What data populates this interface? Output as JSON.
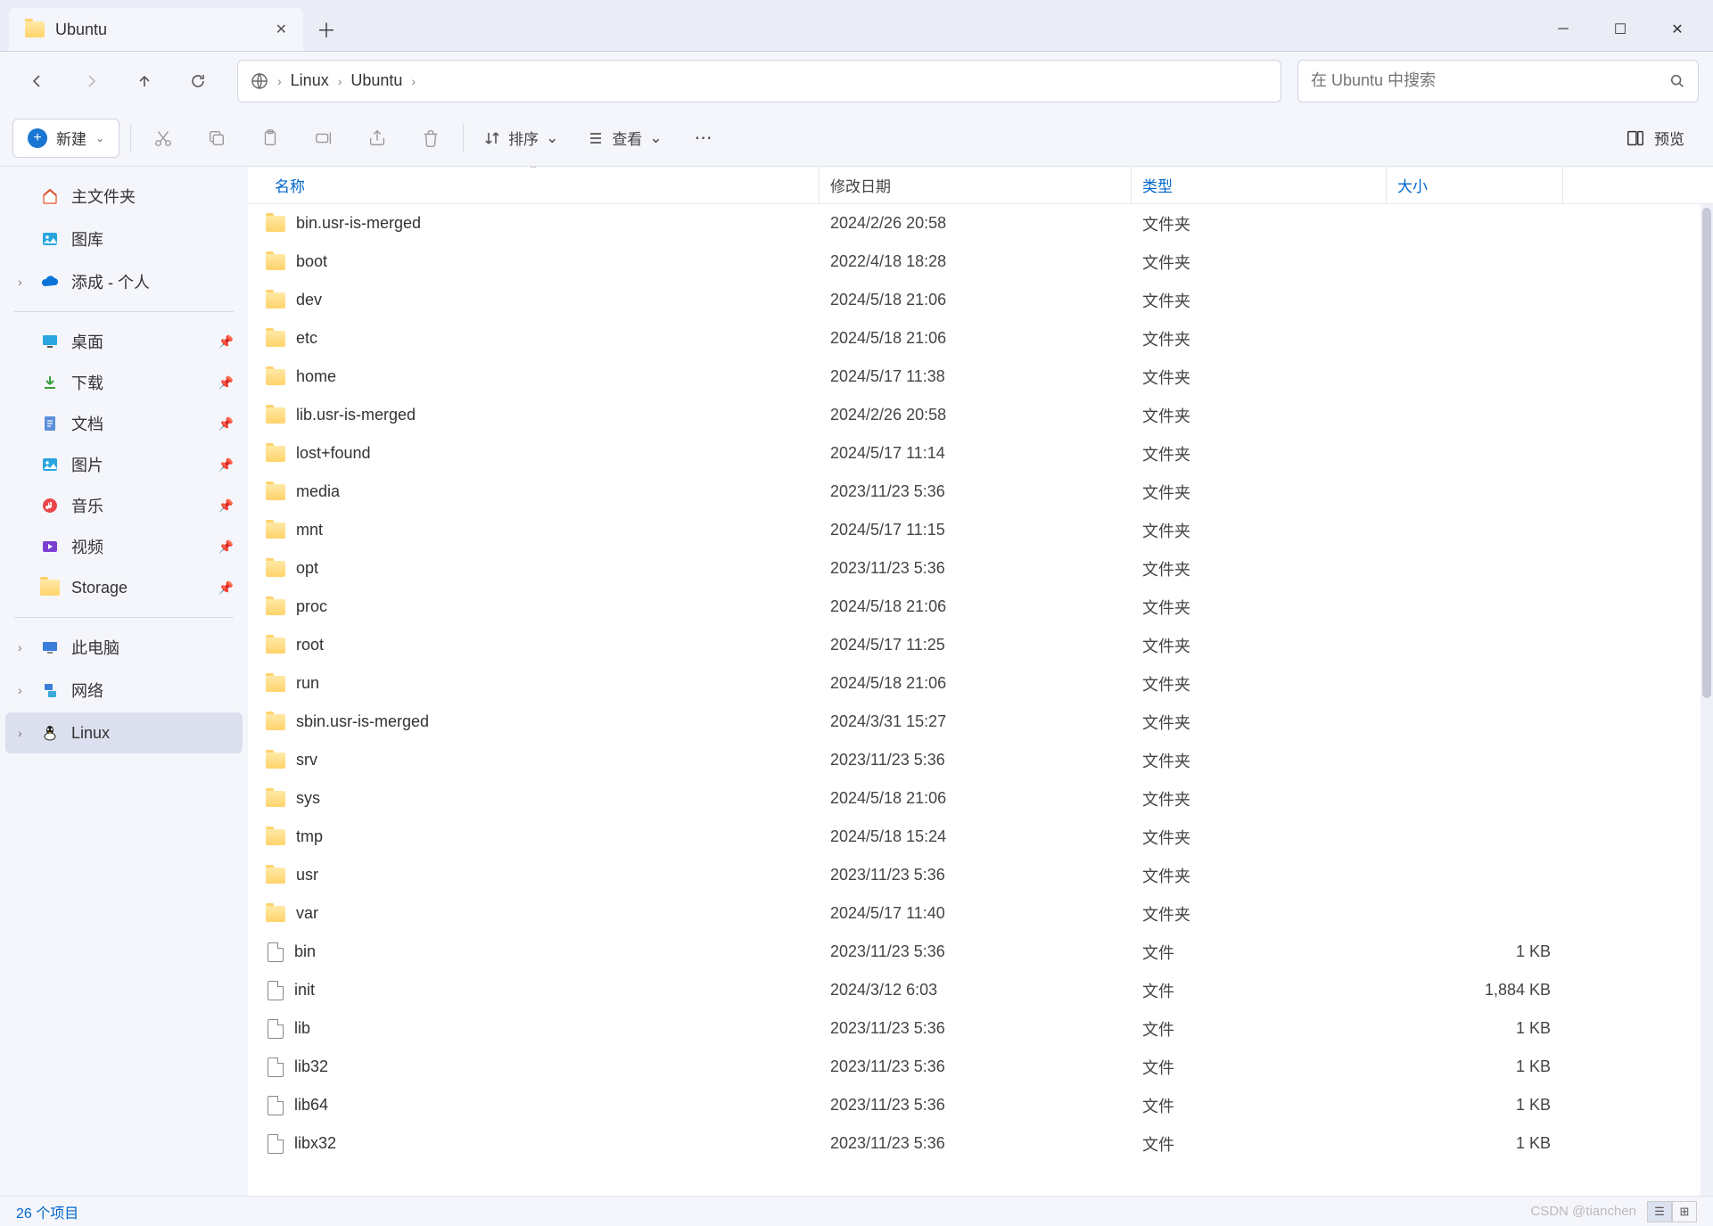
{
  "tab": {
    "title": "Ubuntu"
  },
  "breadcrumbs": [
    "Linux",
    "Ubuntu"
  ],
  "search": {
    "placeholder": "在 Ubuntu 中搜索"
  },
  "toolbar": {
    "new_label": "新建",
    "sort_label": "排序",
    "view_label": "查看",
    "preview_label": "预览"
  },
  "sidebar": {
    "home": "主文件夹",
    "gallery": "图库",
    "onedrive": "添成 - 个人",
    "quick": [
      {
        "label": "桌面",
        "icon": "desktop"
      },
      {
        "label": "下载",
        "icon": "download"
      },
      {
        "label": "文档",
        "icon": "document"
      },
      {
        "label": "图片",
        "icon": "picture"
      },
      {
        "label": "音乐",
        "icon": "music"
      },
      {
        "label": "视频",
        "icon": "video"
      },
      {
        "label": "Storage",
        "icon": "folder"
      }
    ],
    "thispc": "此电脑",
    "network": "网络",
    "linux": "Linux"
  },
  "columns": {
    "name": "名称",
    "date": "修改日期",
    "type": "类型",
    "size": "大小"
  },
  "type_folder": "文件夹",
  "type_file": "文件",
  "files": [
    {
      "name": "bin.usr-is-merged",
      "date": "2024/2/26 20:58",
      "type": "folder",
      "size": ""
    },
    {
      "name": "boot",
      "date": "2022/4/18 18:28",
      "type": "folder",
      "size": ""
    },
    {
      "name": "dev",
      "date": "2024/5/18 21:06",
      "type": "folder",
      "size": ""
    },
    {
      "name": "etc",
      "date": "2024/5/18 21:06",
      "type": "folder",
      "size": ""
    },
    {
      "name": "home",
      "date": "2024/5/17 11:38",
      "type": "folder",
      "size": ""
    },
    {
      "name": "lib.usr-is-merged",
      "date": "2024/2/26 20:58",
      "type": "folder",
      "size": ""
    },
    {
      "name": "lost+found",
      "date": "2024/5/17 11:14",
      "type": "folder",
      "size": ""
    },
    {
      "name": "media",
      "date": "2023/11/23 5:36",
      "type": "folder",
      "size": ""
    },
    {
      "name": "mnt",
      "date": "2024/5/17 11:15",
      "type": "folder",
      "size": ""
    },
    {
      "name": "opt",
      "date": "2023/11/23 5:36",
      "type": "folder",
      "size": ""
    },
    {
      "name": "proc",
      "date": "2024/5/18 21:06",
      "type": "folder",
      "size": ""
    },
    {
      "name": "root",
      "date": "2024/5/17 11:25",
      "type": "folder",
      "size": ""
    },
    {
      "name": "run",
      "date": "2024/5/18 21:06",
      "type": "folder",
      "size": ""
    },
    {
      "name": "sbin.usr-is-merged",
      "date": "2024/3/31 15:27",
      "type": "folder",
      "size": ""
    },
    {
      "name": "srv",
      "date": "2023/11/23 5:36",
      "type": "folder",
      "size": ""
    },
    {
      "name": "sys",
      "date": "2024/5/18 21:06",
      "type": "folder",
      "size": ""
    },
    {
      "name": "tmp",
      "date": "2024/5/18 15:24",
      "type": "folder",
      "size": ""
    },
    {
      "name": "usr",
      "date": "2023/11/23 5:36",
      "type": "folder",
      "size": ""
    },
    {
      "name": "var",
      "date": "2024/5/17 11:40",
      "type": "folder",
      "size": ""
    },
    {
      "name": "bin",
      "date": "2023/11/23 5:36",
      "type": "file",
      "size": "1 KB"
    },
    {
      "name": "init",
      "date": "2024/3/12 6:03",
      "type": "file",
      "size": "1,884 KB"
    },
    {
      "name": "lib",
      "date": "2023/11/23 5:36",
      "type": "file",
      "size": "1 KB"
    },
    {
      "name": "lib32",
      "date": "2023/11/23 5:36",
      "type": "file",
      "size": "1 KB"
    },
    {
      "name": "lib64",
      "date": "2023/11/23 5:36",
      "type": "file",
      "size": "1 KB"
    },
    {
      "name": "libx32",
      "date": "2023/11/23 5:36",
      "type": "file",
      "size": "1 KB"
    }
  ],
  "status": "26 个项目",
  "watermark": "CSDN @tianchen"
}
